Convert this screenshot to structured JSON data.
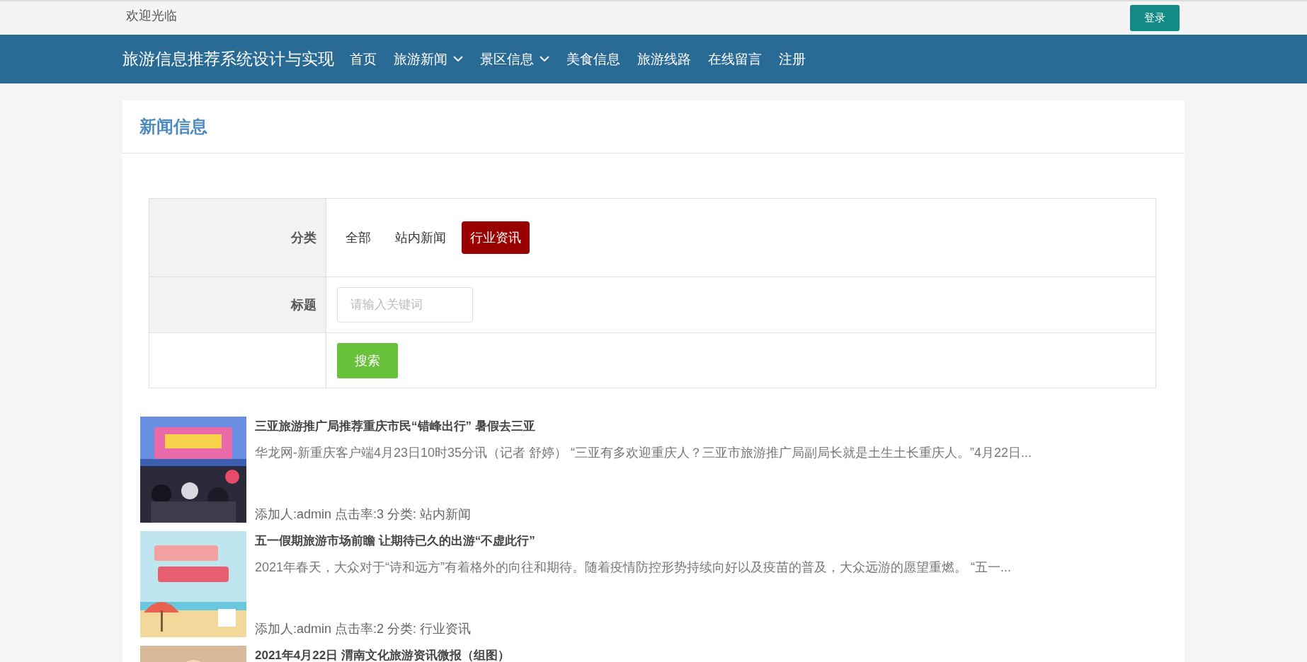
{
  "top_bar": {
    "greeting": "欢迎光临",
    "login_button": "登录"
  },
  "navbar": {
    "brand": "旅游信息推荐系统设计与实现",
    "items": [
      {
        "label": "首页",
        "dropdown": false
      },
      {
        "label": "旅游新闻",
        "dropdown": true
      },
      {
        "label": "景区信息",
        "dropdown": true
      },
      {
        "label": "美食信息",
        "dropdown": false
      },
      {
        "label": "旅游线路",
        "dropdown": false
      },
      {
        "label": "在线留言",
        "dropdown": false
      },
      {
        "label": "注册",
        "dropdown": false
      }
    ]
  },
  "panel": {
    "title": "新闻信息"
  },
  "filter": {
    "category_label": "分类",
    "categories": [
      {
        "label": "全部",
        "selected": false
      },
      {
        "label": "站内新闻",
        "selected": false
      },
      {
        "label": "行业资讯",
        "selected": true
      }
    ],
    "title_label": "标题",
    "title_field": {
      "placeholder": "请输入关键词"
    },
    "search_button": "搜索"
  },
  "news": [
    {
      "title": "三亚旅游推广局推荐重庆市民“错峰出行” 暑假去三亚",
      "summary": "华龙网-新重庆客户端4月23日10时35分讯（记者 舒婷）  “三亚有多欢迎重庆人？三亚市旅游推广局副局长就是土生土长重庆人。”4月22日...",
      "meta": "添加人:admin  点击率:3  分类: 站内新闻",
      "kind": "picture"
    },
    {
      "title": "五一假期旅游市场前瞻 让期待已久的出游“不虚此行”",
      "summary": "2021年春天，大众对于“诗和远方”有着格外的向往和期待。随着疫情防控形势持续向好以及疫苗的普及，大众远游的愿望重燃。 “五一...",
      "meta": "添加人:admin  点击率:2  分类: 行业资讯",
      "kind": "picture"
    },
    {
      "title": "2021年4月22日 渭南文化旅游资讯微报（组图）",
      "kind": "picture"
    }
  ]
}
